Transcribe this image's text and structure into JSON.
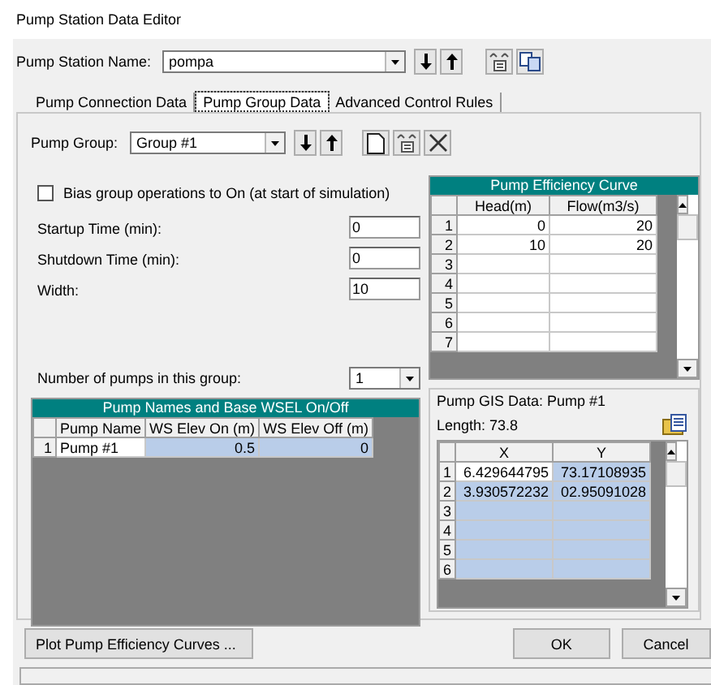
{
  "window": {
    "title": "Pump Station Data Editor"
  },
  "station": {
    "label": "Pump Station Name:",
    "value": "pompa"
  },
  "tabs": [
    {
      "label": "Pump Connection Data",
      "selected": false
    },
    {
      "label": "Pump Group Data",
      "selected": true
    },
    {
      "label": "Advanced Control Rules",
      "selected": false
    }
  ],
  "group": {
    "label": "Pump Group:",
    "value": "Group #1"
  },
  "bias": {
    "label": "Bias group operations to On (at start of simulation)",
    "checked": false
  },
  "fields": [
    {
      "label": "Startup Time (min):",
      "value": "0"
    },
    {
      "label": "Shutdown Time (min):",
      "value": "0"
    },
    {
      "label": "Width:",
      "value": "10"
    }
  ],
  "pump_count": {
    "label": "Number of pumps in this group:",
    "value": "1"
  },
  "pump_table": {
    "title": "Pump Names and Base WSEL On/Off",
    "columns": [
      "Pump Name",
      "WS Elev On (m)",
      "WS Elev Off (m)"
    ],
    "rows": [
      {
        "number": "1",
        "cells": [
          {
            "text": "Pump #1",
            "selected": false
          },
          {
            "text": "0.5",
            "selected": true
          },
          {
            "text": "0",
            "selected": true
          }
        ]
      }
    ]
  },
  "efficiency_table": {
    "title": "Pump Efficiency Curve",
    "columns": [
      "Head(m)",
      "Flow(m3/s)"
    ],
    "rows": [
      {
        "number": "1",
        "cells": [
          {
            "text": "0",
            "selected": false
          },
          {
            "text": "20",
            "selected": false
          }
        ]
      },
      {
        "number": "2",
        "cells": [
          {
            "text": "10",
            "selected": false
          },
          {
            "text": "20",
            "selected": false
          }
        ]
      },
      {
        "number": "3",
        "cells": [
          {
            "selected": false
          },
          {
            "selected": false
          }
        ]
      },
      {
        "number": "4",
        "cells": [
          {
            "selected": false
          },
          {
            "selected": false
          }
        ]
      },
      {
        "number": "5",
        "cells": [
          {
            "selected": false
          },
          {
            "selected": false
          }
        ]
      },
      {
        "number": "6",
        "cells": [
          {
            "selected": false
          },
          {
            "selected": false
          }
        ]
      },
      {
        "number": "7",
        "cells": [
          {
            "selected": false
          },
          {
            "selected": false
          }
        ]
      }
    ]
  },
  "gis": {
    "title": "Pump GIS Data: Pump #1",
    "length": "Length: 73.8",
    "columns": [
      "X",
      "Y"
    ],
    "rows": [
      {
        "number": "1",
        "cells": [
          {
            "text": "6.429644795",
            "selected": false
          },
          {
            "text": "73.17108935",
            "selected": true
          }
        ]
      },
      {
        "number": "2",
        "cells": [
          {
            "text": "3.930572232",
            "selected": true
          },
          {
            "text": "02.95091028",
            "selected": true
          }
        ]
      },
      {
        "number": "3",
        "cells": [
          {
            "selected": true
          },
          {
            "selected": true
          }
        ]
      },
      {
        "number": "4",
        "cells": [
          {
            "selected": true
          },
          {
            "selected": true
          }
        ]
      },
      {
        "number": "5",
        "cells": [
          {
            "selected": true
          },
          {
            "selected": true
          }
        ]
      },
      {
        "number": "6",
        "cells": [
          {
            "selected": true
          },
          {
            "selected": true
          }
        ]
      }
    ]
  },
  "buttons": [
    "Plot Pump Efficiency Curves ...",
    "OK",
    "Cancel"
  ]
}
